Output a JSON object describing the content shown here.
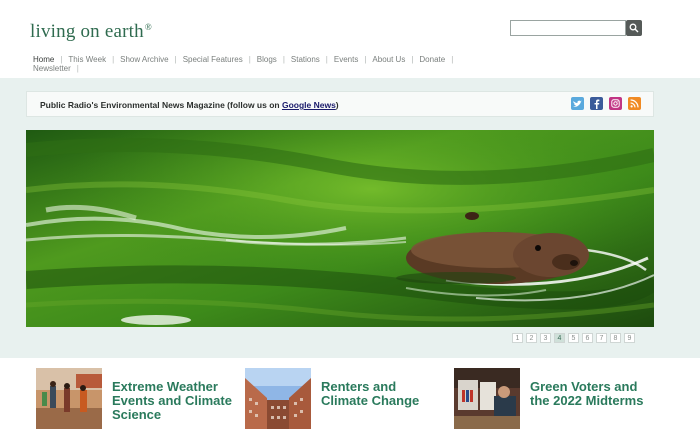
{
  "site": {
    "logo_text": "living on earth",
    "logo_mark": "®"
  },
  "search": {
    "placeholder": ""
  },
  "nav": {
    "items": [
      "Home",
      "This Week",
      "Show Archive",
      "Special Features",
      "Blogs",
      "Stations",
      "Events",
      "About Us",
      "Donate",
      "Newsletter"
    ]
  },
  "tagline": {
    "prefix": "Public Radio's Environmental News Magazine (follow us on ",
    "link": "Google News",
    "suffix": ")"
  },
  "social_icons": [
    "twitter-icon",
    "facebook-icon",
    "instagram-icon",
    "rss-icon"
  ],
  "pager": {
    "pages": [
      "1",
      "2",
      "3",
      "4",
      "5",
      "6",
      "7",
      "8",
      "9"
    ],
    "current": "4"
  },
  "features": [
    {
      "title": "Extreme Weather Events and Climate Science"
    },
    {
      "title": "Renters and Climate Change"
    },
    {
      "title": "Green Voters and the 2022 Midterms"
    }
  ],
  "colors": {
    "brand_green": "#2f6b4f",
    "feature_title": "#2a7a5c",
    "background": "#e8f1ef"
  }
}
